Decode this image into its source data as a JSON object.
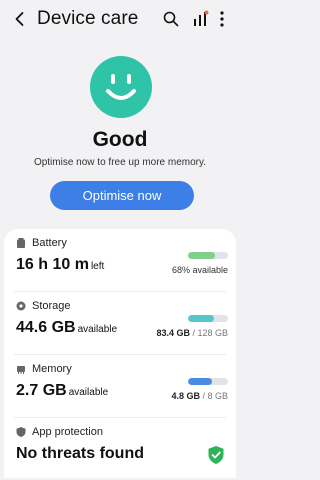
{
  "header": {
    "title": "Device care"
  },
  "status": {
    "label": "Good",
    "message": "Optimise now to free up more memory.",
    "button": "Optimise now"
  },
  "battery": {
    "label": "Battery",
    "value": "16 h 10 m",
    "unit": "left",
    "detail": "68% available",
    "level": 0.68,
    "color": "#7fd18a"
  },
  "storage": {
    "label": "Storage",
    "value": "44.6 GB",
    "unit": "available",
    "used": "83.4 GB",
    "total": " / 128 GB",
    "level": 0.65,
    "color": "#56c7c9"
  },
  "memory": {
    "label": "Memory",
    "value": "2.7 GB",
    "unit": "available",
    "used": "4.8 GB",
    "total": " / 8 GB",
    "level": 0.6,
    "color": "#4a8de0"
  },
  "protection": {
    "label": "App protection",
    "value": "No threats found"
  },
  "colors": {
    "accent": "#3d7fe6",
    "face": "#2fc3a7",
    "shield": "#2fb35a"
  }
}
